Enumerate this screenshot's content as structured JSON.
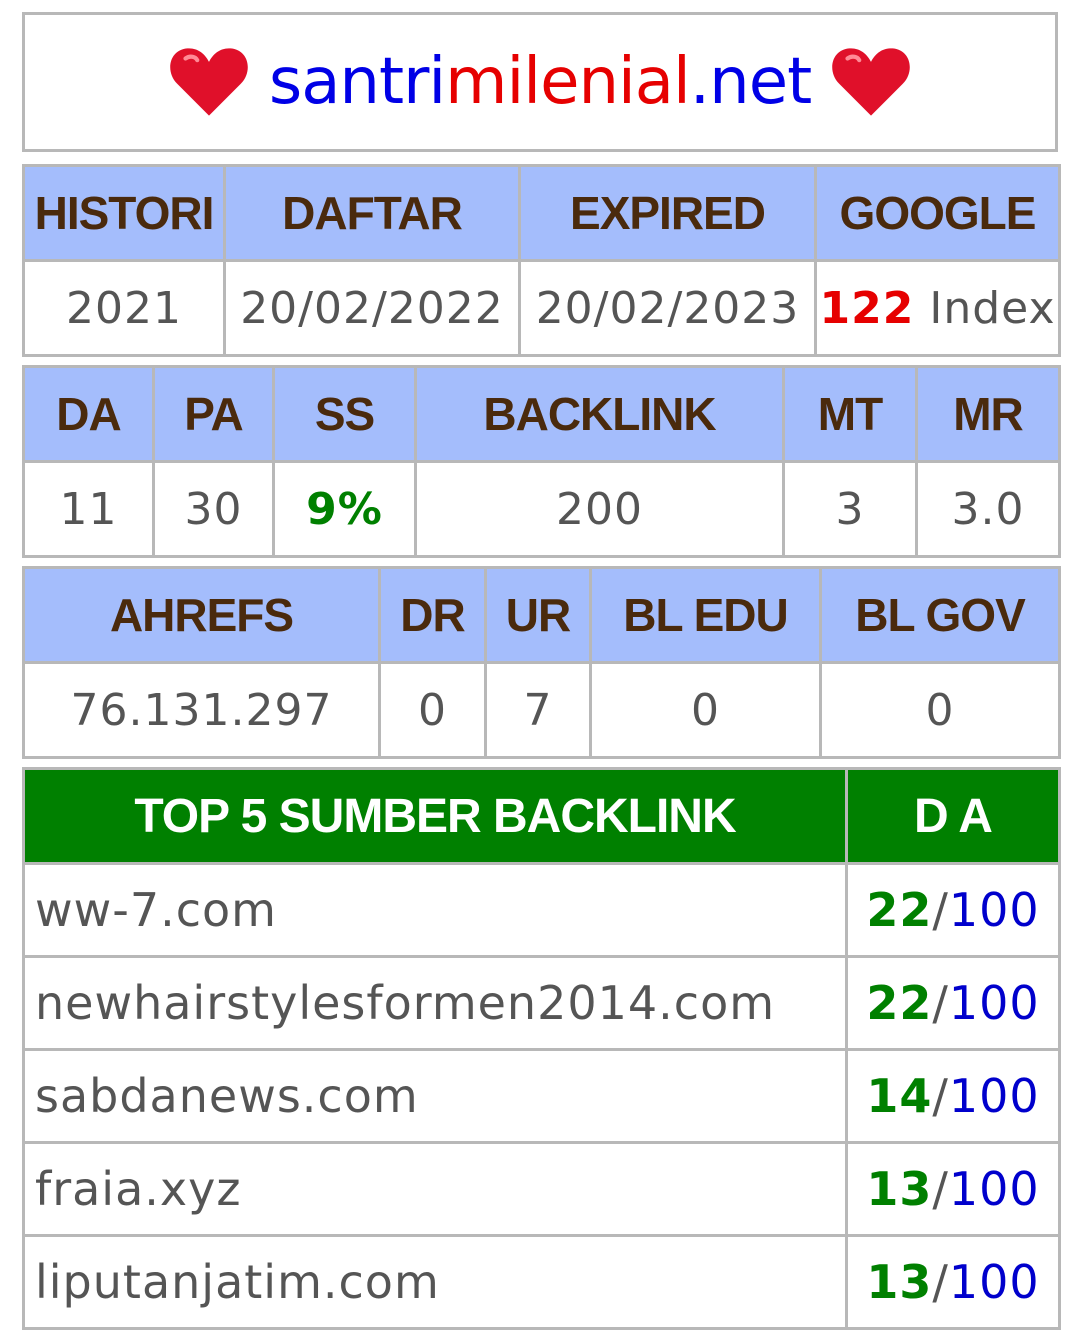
{
  "title": {
    "part1": "santri",
    "part2": "milenial",
    "part3": ".net",
    "icon_left": "heart-icon",
    "icon_right": "heart-icon"
  },
  "colors": {
    "header_bg": "#a4bdfc",
    "header_text": "#4a2a0d",
    "top5_header_bg": "#008000",
    "title_blue": "#0000e6",
    "title_red": "#e60000",
    "highlight_green": "#008000",
    "highlight_red": "#e60000",
    "heart": "#e0102a"
  },
  "table1": {
    "headers": [
      "HISTORI",
      "DAFTAR",
      "EXPIRED",
      "GOOGLE"
    ],
    "histori": "2021",
    "daftar": "20/02/2022",
    "expired": "20/02/2023",
    "google_count": "122",
    "google_label": "Index"
  },
  "table2": {
    "headers": [
      "DA",
      "PA",
      "SS",
      "BACKLINK",
      "MT",
      "MR"
    ],
    "values": [
      "11",
      "30",
      "9%",
      "200",
      "3",
      "3.0"
    ]
  },
  "table3": {
    "headers": [
      "AHREFS",
      "DR",
      "UR",
      "BL EDU",
      "BL GOV"
    ],
    "values": [
      "76.131.297",
      "0",
      "7",
      "0",
      "0"
    ]
  },
  "table4": {
    "headers": [
      "TOP 5 SUMBER BACKLINK",
      "D A"
    ],
    "rows": [
      {
        "source": "ww-7.com",
        "da": "22",
        "max": "100"
      },
      {
        "source": "newhairstylesformen2014.com",
        "da": "22",
        "max": "100"
      },
      {
        "source": "sabdanews.com",
        "da": "14",
        "max": "100"
      },
      {
        "source": "fraia.xyz",
        "da": "13",
        "max": "100"
      },
      {
        "source": "liputanjatim.com",
        "da": "13",
        "max": "100"
      }
    ]
  }
}
